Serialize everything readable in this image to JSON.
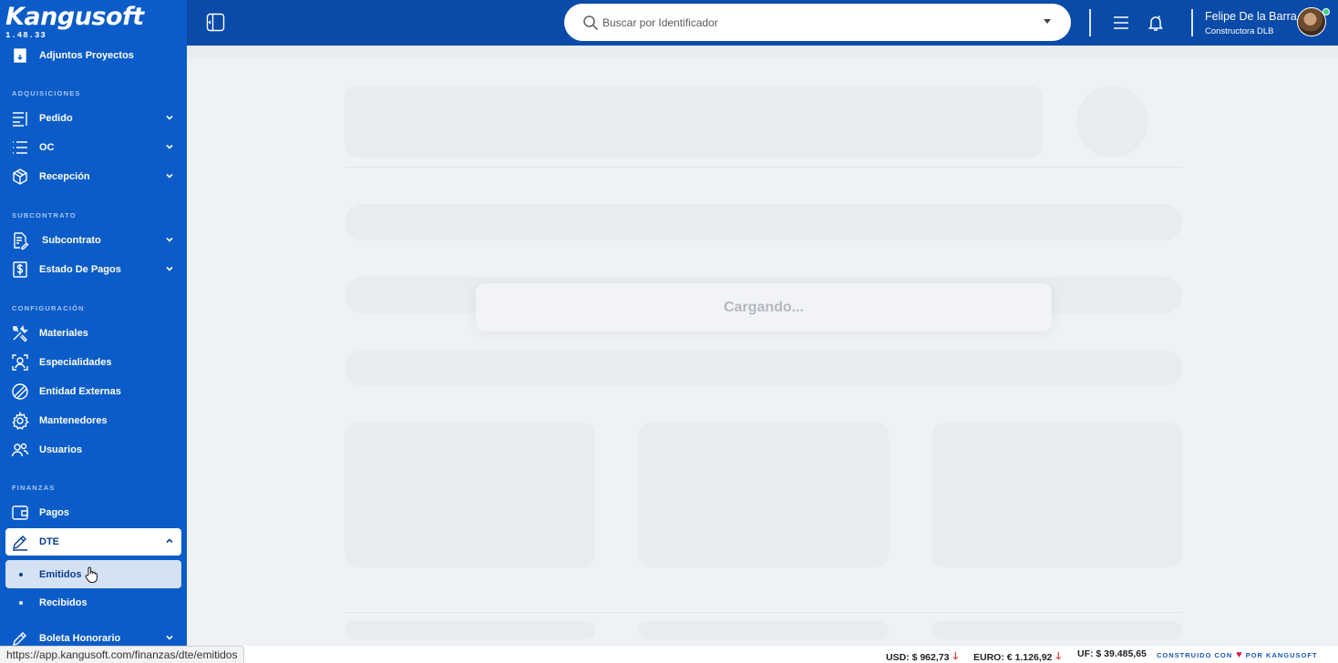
{
  "brand": {
    "name": "Kangusoft",
    "version": "1.48.33"
  },
  "sidebar": {
    "top_item": {
      "label": "Adjuntos Proyectos",
      "icon": "archive-icon"
    },
    "sections": {
      "adquisiciones": "ADQUISICIONES",
      "subcontrato": "SUBCONTRATO",
      "configuracion": "CONFIGURACIÓN",
      "finanzas": "FINANZAS"
    },
    "items": {
      "pedido": "Pedido",
      "oc": "OC",
      "recepcion": "Recepción",
      "subcontrato": "Subcontrato",
      "estado_pagos": "Estado De Pagos",
      "materiales": "Materiales",
      "especialidades": "Especialidades",
      "entidad_externas": "Entidad Externas",
      "mantenedores": "Mantenedores",
      "usuarios": "Usuarios",
      "pagos": "Pagos",
      "dte": "DTE",
      "emitidos": "Emitidos",
      "recibidos": "Recibidos",
      "boleta_honorario": "Boleta Honorario"
    },
    "active_item": "DTE",
    "selected_subitem": "Emitidos"
  },
  "header": {
    "search_placeholder": "Buscar por Identificador",
    "user_name": "Felipe De la Barra",
    "user_company": "Constructora DLB"
  },
  "main": {
    "loading_text": "Cargando..."
  },
  "status_bar": {
    "url": "https://app.kangusoft.com/finanzas/dte/emitidos"
  },
  "footer": {
    "usd": "USD: $ 962,73",
    "euro": "EURO: € 1.126,92",
    "uf": "UF: $ 39.485,65",
    "built_prefix": "CONSTRUIDO CON",
    "built_suffix": "POR KANGUSOFT",
    "down_arrow": "🡓",
    "heart": "♥"
  },
  "colors": {
    "sidebar_bg": "#0b5cc8",
    "header_bg": "#0a4aa8",
    "content_bg": "#eef1f5",
    "skeleton": "#e8ebf0",
    "trend_down": "#d93025"
  }
}
